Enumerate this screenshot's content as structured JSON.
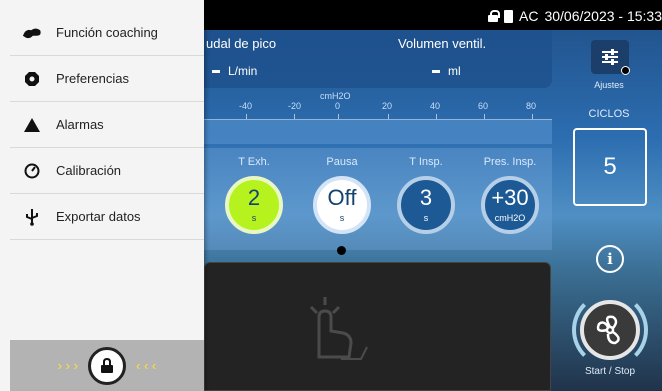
{
  "status_bar": {
    "power": "AC",
    "datetime": "30/06/2023 - 15:33",
    "icons": [
      "lock-icon",
      "battery-icon"
    ]
  },
  "drawer": {
    "items": [
      {
        "label": "Función coaching",
        "icon": "coaching-icon"
      },
      {
        "label": "Preferencias",
        "icon": "gear-icon"
      },
      {
        "label": "Alarmas",
        "icon": "warning-triangle-icon"
      },
      {
        "label": "Calibración",
        "icon": "gauge-icon"
      },
      {
        "label": "Exportar datos",
        "icon": "usb-icon"
      }
    ],
    "lock_slider": {
      "left_arrows": "› › ›",
      "right_arrows": "‹ ‹ ‹",
      "icon": "lock-icon"
    }
  },
  "monitor": {
    "peak_flow_label": "udal de pico",
    "peak_flow_unit": "L/min",
    "volume_label": "Volumen ventil.",
    "volume_unit": "ml"
  },
  "scale": {
    "unit": "cmH2O",
    "ticks": [
      "-40",
      "-20",
      "0",
      "20",
      "40",
      "60",
      "80"
    ]
  },
  "params": [
    {
      "label": "T Exh.",
      "value": "2",
      "unit": "s"
    },
    {
      "label": "Pausa",
      "value": "Off",
      "unit": "s"
    },
    {
      "label": "T Insp.",
      "value": "3",
      "unit": "s"
    },
    {
      "label": "Pres. Insp.",
      "value": "+30",
      "unit": "cmH2O"
    }
  ],
  "right_panel": {
    "settings_label": "Ajustes",
    "cycles_label": "CICLOS",
    "cycles_value": "5",
    "info_icon": "i",
    "start_label": "Start / Stop"
  },
  "colors": {
    "accent_green": "#b6f21e",
    "dark_blue": "#1d5a95",
    "lock_arrows": "#ffe02f"
  }
}
